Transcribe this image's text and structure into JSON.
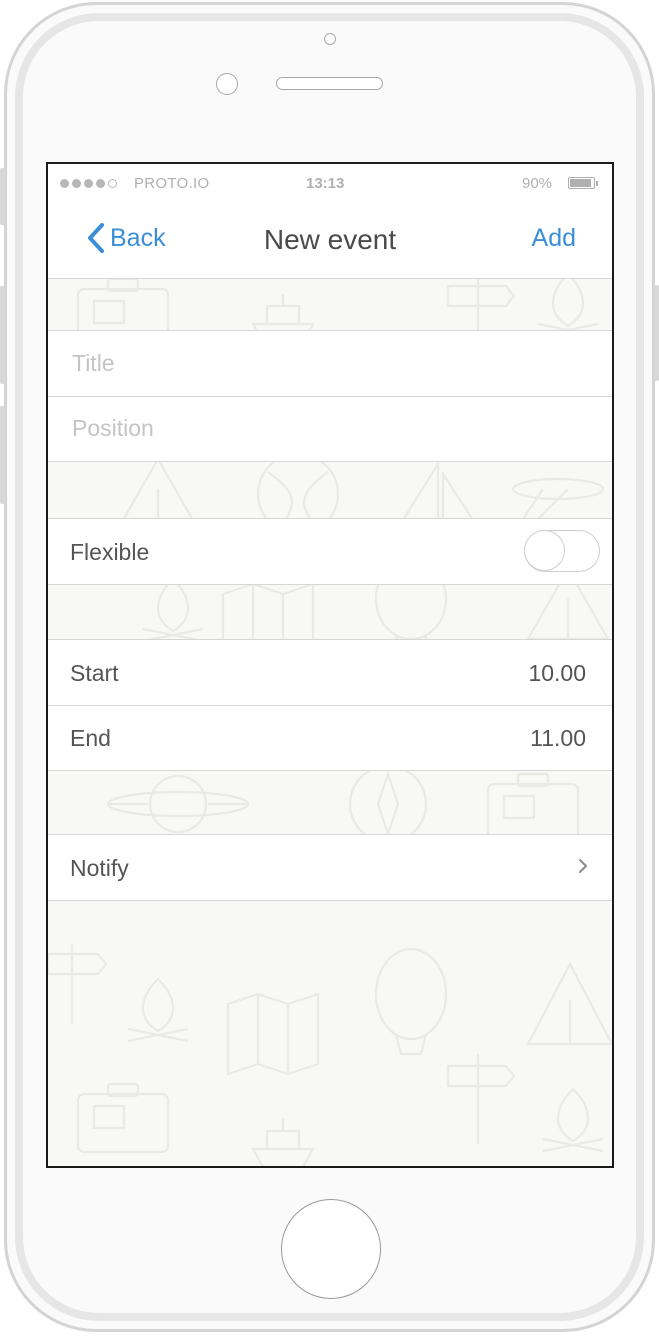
{
  "status_bar": {
    "carrier": "PROTO.IO",
    "signal_bars_filled": 4,
    "signal_bars_total": 5,
    "time": "13:13",
    "battery_percent": "90%",
    "battery_level": 0.9
  },
  "nav": {
    "back_label": "Back",
    "title": "New event",
    "add_label": "Add",
    "accent_color": "#3b8fd9"
  },
  "form": {
    "title_placeholder": "Title",
    "title_value": "",
    "position_placeholder": "Position",
    "position_value": "",
    "flexible_label": "Flexible",
    "flexible_on": false,
    "start_label": "Start",
    "start_value": "10.00",
    "end_label": "End",
    "end_value": "11.00",
    "notify_label": "Notify"
  },
  "icons": {
    "back": "chevron-left-icon",
    "notify": "chevron-right-icon",
    "background": [
      "suitcase-icon",
      "ship-icon",
      "signpost-icon",
      "campfire-icon",
      "tent-icon",
      "beach-ball-icon",
      "sailboat-icon",
      "map-icon",
      "hot-air-balloon-icon",
      "airplane-icon",
      "compass-icon"
    ]
  }
}
